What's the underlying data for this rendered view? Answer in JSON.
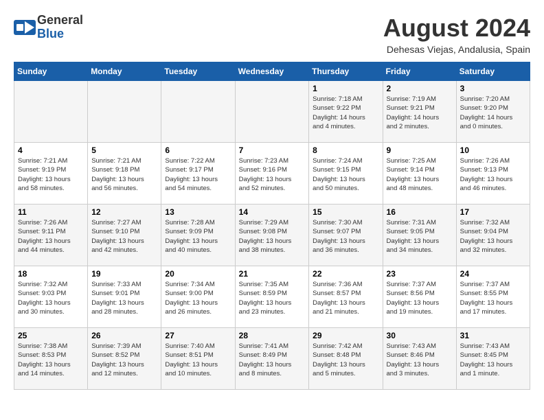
{
  "header": {
    "logo_general": "General",
    "logo_blue": "Blue",
    "month_year": "August 2024",
    "location": "Dehesas Viejas, Andalusia, Spain"
  },
  "days_of_week": [
    "Sunday",
    "Monday",
    "Tuesday",
    "Wednesday",
    "Thursday",
    "Friday",
    "Saturday"
  ],
  "weeks": [
    [
      {
        "day": "",
        "info": ""
      },
      {
        "day": "",
        "info": ""
      },
      {
        "day": "",
        "info": ""
      },
      {
        "day": "",
        "info": ""
      },
      {
        "day": "1",
        "info": "Sunrise: 7:18 AM\nSunset: 9:22 PM\nDaylight: 14 hours\nand 4 minutes."
      },
      {
        "day": "2",
        "info": "Sunrise: 7:19 AM\nSunset: 9:21 PM\nDaylight: 14 hours\nand 2 minutes."
      },
      {
        "day": "3",
        "info": "Sunrise: 7:20 AM\nSunset: 9:20 PM\nDaylight: 14 hours\nand 0 minutes."
      }
    ],
    [
      {
        "day": "4",
        "info": "Sunrise: 7:21 AM\nSunset: 9:19 PM\nDaylight: 13 hours\nand 58 minutes."
      },
      {
        "day": "5",
        "info": "Sunrise: 7:21 AM\nSunset: 9:18 PM\nDaylight: 13 hours\nand 56 minutes."
      },
      {
        "day": "6",
        "info": "Sunrise: 7:22 AM\nSunset: 9:17 PM\nDaylight: 13 hours\nand 54 minutes."
      },
      {
        "day": "7",
        "info": "Sunrise: 7:23 AM\nSunset: 9:16 PM\nDaylight: 13 hours\nand 52 minutes."
      },
      {
        "day": "8",
        "info": "Sunrise: 7:24 AM\nSunset: 9:15 PM\nDaylight: 13 hours\nand 50 minutes."
      },
      {
        "day": "9",
        "info": "Sunrise: 7:25 AM\nSunset: 9:14 PM\nDaylight: 13 hours\nand 48 minutes."
      },
      {
        "day": "10",
        "info": "Sunrise: 7:26 AM\nSunset: 9:13 PM\nDaylight: 13 hours\nand 46 minutes."
      }
    ],
    [
      {
        "day": "11",
        "info": "Sunrise: 7:26 AM\nSunset: 9:11 PM\nDaylight: 13 hours\nand 44 minutes."
      },
      {
        "day": "12",
        "info": "Sunrise: 7:27 AM\nSunset: 9:10 PM\nDaylight: 13 hours\nand 42 minutes."
      },
      {
        "day": "13",
        "info": "Sunrise: 7:28 AM\nSunset: 9:09 PM\nDaylight: 13 hours\nand 40 minutes."
      },
      {
        "day": "14",
        "info": "Sunrise: 7:29 AM\nSunset: 9:08 PM\nDaylight: 13 hours\nand 38 minutes."
      },
      {
        "day": "15",
        "info": "Sunrise: 7:30 AM\nSunset: 9:07 PM\nDaylight: 13 hours\nand 36 minutes."
      },
      {
        "day": "16",
        "info": "Sunrise: 7:31 AM\nSunset: 9:05 PM\nDaylight: 13 hours\nand 34 minutes."
      },
      {
        "day": "17",
        "info": "Sunrise: 7:32 AM\nSunset: 9:04 PM\nDaylight: 13 hours\nand 32 minutes."
      }
    ],
    [
      {
        "day": "18",
        "info": "Sunrise: 7:32 AM\nSunset: 9:03 PM\nDaylight: 13 hours\nand 30 minutes."
      },
      {
        "day": "19",
        "info": "Sunrise: 7:33 AM\nSunset: 9:01 PM\nDaylight: 13 hours\nand 28 minutes."
      },
      {
        "day": "20",
        "info": "Sunrise: 7:34 AM\nSunset: 9:00 PM\nDaylight: 13 hours\nand 26 minutes."
      },
      {
        "day": "21",
        "info": "Sunrise: 7:35 AM\nSunset: 8:59 PM\nDaylight: 13 hours\nand 23 minutes."
      },
      {
        "day": "22",
        "info": "Sunrise: 7:36 AM\nSunset: 8:57 PM\nDaylight: 13 hours\nand 21 minutes."
      },
      {
        "day": "23",
        "info": "Sunrise: 7:37 AM\nSunset: 8:56 PM\nDaylight: 13 hours\nand 19 minutes."
      },
      {
        "day": "24",
        "info": "Sunrise: 7:37 AM\nSunset: 8:55 PM\nDaylight: 13 hours\nand 17 minutes."
      }
    ],
    [
      {
        "day": "25",
        "info": "Sunrise: 7:38 AM\nSunset: 8:53 PM\nDaylight: 13 hours\nand 14 minutes."
      },
      {
        "day": "26",
        "info": "Sunrise: 7:39 AM\nSunset: 8:52 PM\nDaylight: 13 hours\nand 12 minutes."
      },
      {
        "day": "27",
        "info": "Sunrise: 7:40 AM\nSunset: 8:51 PM\nDaylight: 13 hours\nand 10 minutes."
      },
      {
        "day": "28",
        "info": "Sunrise: 7:41 AM\nSunset: 8:49 PM\nDaylight: 13 hours\nand 8 minutes."
      },
      {
        "day": "29",
        "info": "Sunrise: 7:42 AM\nSunset: 8:48 PM\nDaylight: 13 hours\nand 5 minutes."
      },
      {
        "day": "30",
        "info": "Sunrise: 7:43 AM\nSunset: 8:46 PM\nDaylight: 13 hours\nand 3 minutes."
      },
      {
        "day": "31",
        "info": "Sunrise: 7:43 AM\nSunset: 8:45 PM\nDaylight: 13 hours\nand 1 minute."
      }
    ]
  ]
}
